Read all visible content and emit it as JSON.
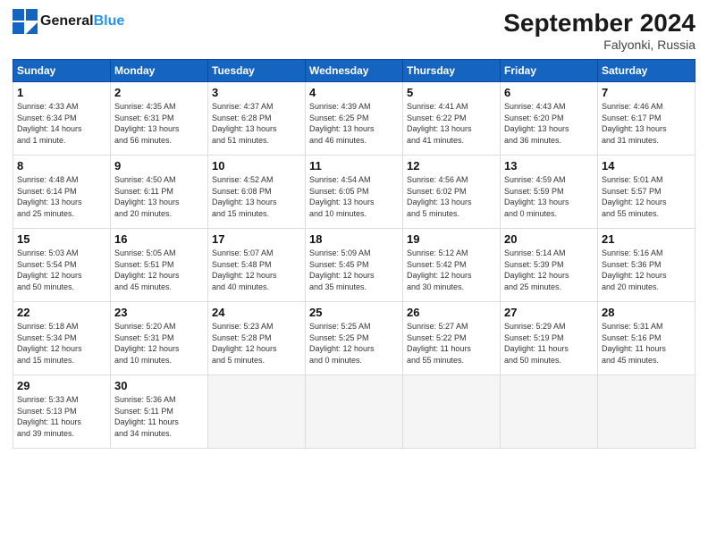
{
  "header": {
    "logo_line1": "General",
    "logo_line2": "Blue",
    "month_title": "September 2024",
    "location": "Falyonki, Russia"
  },
  "days_of_week": [
    "Sunday",
    "Monday",
    "Tuesday",
    "Wednesday",
    "Thursday",
    "Friday",
    "Saturday"
  ],
  "weeks": [
    [
      {
        "day": "1",
        "lines": [
          "Sunrise: 4:33 AM",
          "Sunset: 6:34 PM",
          "Daylight: 14 hours",
          "and 1 minute."
        ]
      },
      {
        "day": "2",
        "lines": [
          "Sunrise: 4:35 AM",
          "Sunset: 6:31 PM",
          "Daylight: 13 hours",
          "and 56 minutes."
        ]
      },
      {
        "day": "3",
        "lines": [
          "Sunrise: 4:37 AM",
          "Sunset: 6:28 PM",
          "Daylight: 13 hours",
          "and 51 minutes."
        ]
      },
      {
        "day": "4",
        "lines": [
          "Sunrise: 4:39 AM",
          "Sunset: 6:25 PM",
          "Daylight: 13 hours",
          "and 46 minutes."
        ]
      },
      {
        "day": "5",
        "lines": [
          "Sunrise: 4:41 AM",
          "Sunset: 6:22 PM",
          "Daylight: 13 hours",
          "and 41 minutes."
        ]
      },
      {
        "day": "6",
        "lines": [
          "Sunrise: 4:43 AM",
          "Sunset: 6:20 PM",
          "Daylight: 13 hours",
          "and 36 minutes."
        ]
      },
      {
        "day": "7",
        "lines": [
          "Sunrise: 4:46 AM",
          "Sunset: 6:17 PM",
          "Daylight: 13 hours",
          "and 31 minutes."
        ]
      }
    ],
    [
      {
        "day": "8",
        "lines": [
          "Sunrise: 4:48 AM",
          "Sunset: 6:14 PM",
          "Daylight: 13 hours",
          "and 25 minutes."
        ]
      },
      {
        "day": "9",
        "lines": [
          "Sunrise: 4:50 AM",
          "Sunset: 6:11 PM",
          "Daylight: 13 hours",
          "and 20 minutes."
        ]
      },
      {
        "day": "10",
        "lines": [
          "Sunrise: 4:52 AM",
          "Sunset: 6:08 PM",
          "Daylight: 13 hours",
          "and 15 minutes."
        ]
      },
      {
        "day": "11",
        "lines": [
          "Sunrise: 4:54 AM",
          "Sunset: 6:05 PM",
          "Daylight: 13 hours",
          "and 10 minutes."
        ]
      },
      {
        "day": "12",
        "lines": [
          "Sunrise: 4:56 AM",
          "Sunset: 6:02 PM",
          "Daylight: 13 hours",
          "and 5 minutes."
        ]
      },
      {
        "day": "13",
        "lines": [
          "Sunrise: 4:59 AM",
          "Sunset: 5:59 PM",
          "Daylight: 13 hours",
          "and 0 minutes."
        ]
      },
      {
        "day": "14",
        "lines": [
          "Sunrise: 5:01 AM",
          "Sunset: 5:57 PM",
          "Daylight: 12 hours",
          "and 55 minutes."
        ]
      }
    ],
    [
      {
        "day": "15",
        "lines": [
          "Sunrise: 5:03 AM",
          "Sunset: 5:54 PM",
          "Daylight: 12 hours",
          "and 50 minutes."
        ]
      },
      {
        "day": "16",
        "lines": [
          "Sunrise: 5:05 AM",
          "Sunset: 5:51 PM",
          "Daylight: 12 hours",
          "and 45 minutes."
        ]
      },
      {
        "day": "17",
        "lines": [
          "Sunrise: 5:07 AM",
          "Sunset: 5:48 PM",
          "Daylight: 12 hours",
          "and 40 minutes."
        ]
      },
      {
        "day": "18",
        "lines": [
          "Sunrise: 5:09 AM",
          "Sunset: 5:45 PM",
          "Daylight: 12 hours",
          "and 35 minutes."
        ]
      },
      {
        "day": "19",
        "lines": [
          "Sunrise: 5:12 AM",
          "Sunset: 5:42 PM",
          "Daylight: 12 hours",
          "and 30 minutes."
        ]
      },
      {
        "day": "20",
        "lines": [
          "Sunrise: 5:14 AM",
          "Sunset: 5:39 PM",
          "Daylight: 12 hours",
          "and 25 minutes."
        ]
      },
      {
        "day": "21",
        "lines": [
          "Sunrise: 5:16 AM",
          "Sunset: 5:36 PM",
          "Daylight: 12 hours",
          "and 20 minutes."
        ]
      }
    ],
    [
      {
        "day": "22",
        "lines": [
          "Sunrise: 5:18 AM",
          "Sunset: 5:34 PM",
          "Daylight: 12 hours",
          "and 15 minutes."
        ]
      },
      {
        "day": "23",
        "lines": [
          "Sunrise: 5:20 AM",
          "Sunset: 5:31 PM",
          "Daylight: 12 hours",
          "and 10 minutes."
        ]
      },
      {
        "day": "24",
        "lines": [
          "Sunrise: 5:23 AM",
          "Sunset: 5:28 PM",
          "Daylight: 12 hours",
          "and 5 minutes."
        ]
      },
      {
        "day": "25",
        "lines": [
          "Sunrise: 5:25 AM",
          "Sunset: 5:25 PM",
          "Daylight: 12 hours",
          "and 0 minutes."
        ]
      },
      {
        "day": "26",
        "lines": [
          "Sunrise: 5:27 AM",
          "Sunset: 5:22 PM",
          "Daylight: 11 hours",
          "and 55 minutes."
        ]
      },
      {
        "day": "27",
        "lines": [
          "Sunrise: 5:29 AM",
          "Sunset: 5:19 PM",
          "Daylight: 11 hours",
          "and 50 minutes."
        ]
      },
      {
        "day": "28",
        "lines": [
          "Sunrise: 5:31 AM",
          "Sunset: 5:16 PM",
          "Daylight: 11 hours",
          "and 45 minutes."
        ]
      }
    ],
    [
      {
        "day": "29",
        "lines": [
          "Sunrise: 5:33 AM",
          "Sunset: 5:13 PM",
          "Daylight: 11 hours",
          "and 39 minutes."
        ]
      },
      {
        "day": "30",
        "lines": [
          "Sunrise: 5:36 AM",
          "Sunset: 5:11 PM",
          "Daylight: 11 hours",
          "and 34 minutes."
        ]
      },
      {
        "day": "",
        "lines": []
      },
      {
        "day": "",
        "lines": []
      },
      {
        "day": "",
        "lines": []
      },
      {
        "day": "",
        "lines": []
      },
      {
        "day": "",
        "lines": []
      }
    ]
  ]
}
